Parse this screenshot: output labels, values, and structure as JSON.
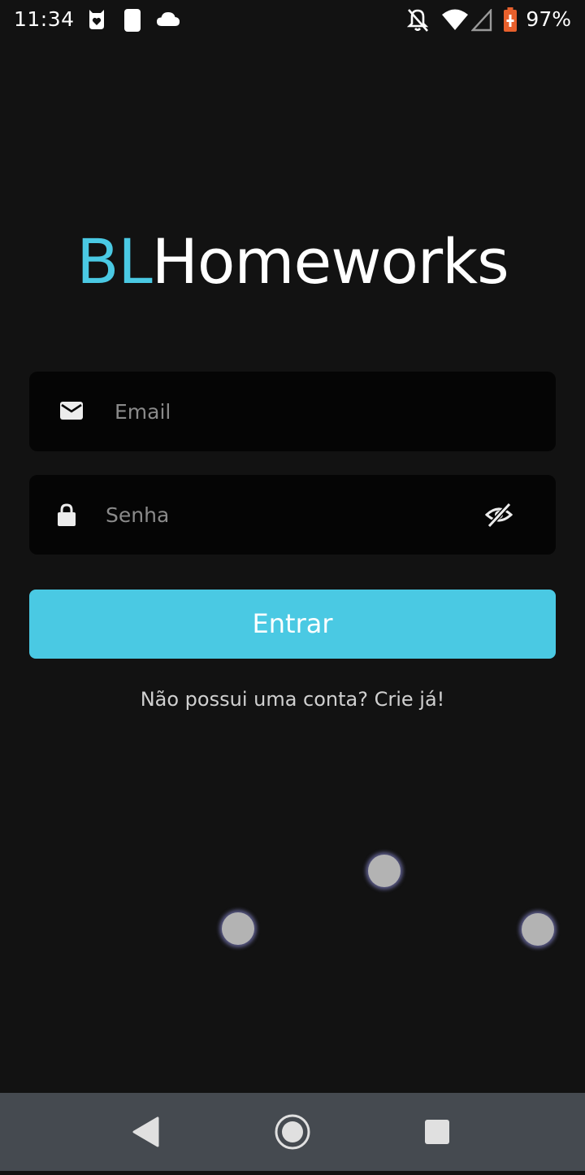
{
  "status_bar": {
    "time": "11:34",
    "battery_percent": "97%",
    "icons": [
      "heart-notification-icon",
      "sleep-mode-icon",
      "cloud-icon",
      "notifications-off-icon",
      "wifi-icon",
      "cell-signal-icon",
      "battery-charging-icon"
    ]
  },
  "logo": {
    "accent": "BL",
    "main": "Homeworks"
  },
  "login_form": {
    "email": {
      "value": "",
      "placeholder": "Email",
      "icon": "email-icon"
    },
    "password": {
      "value": "",
      "placeholder": "Senha",
      "icon": "lock-icon",
      "toggle_icon": "visibility-off-icon"
    },
    "submit_label": "Entrar",
    "signup_text": "Não possui uma conta? Crie já!"
  },
  "nav_bar": {
    "icons": [
      "back-icon",
      "home-icon",
      "recents-icon"
    ]
  },
  "colors": {
    "accent": "#4ac9e3",
    "background": "#121212",
    "field_background": "#050505",
    "nav_background": "#454a50"
  }
}
